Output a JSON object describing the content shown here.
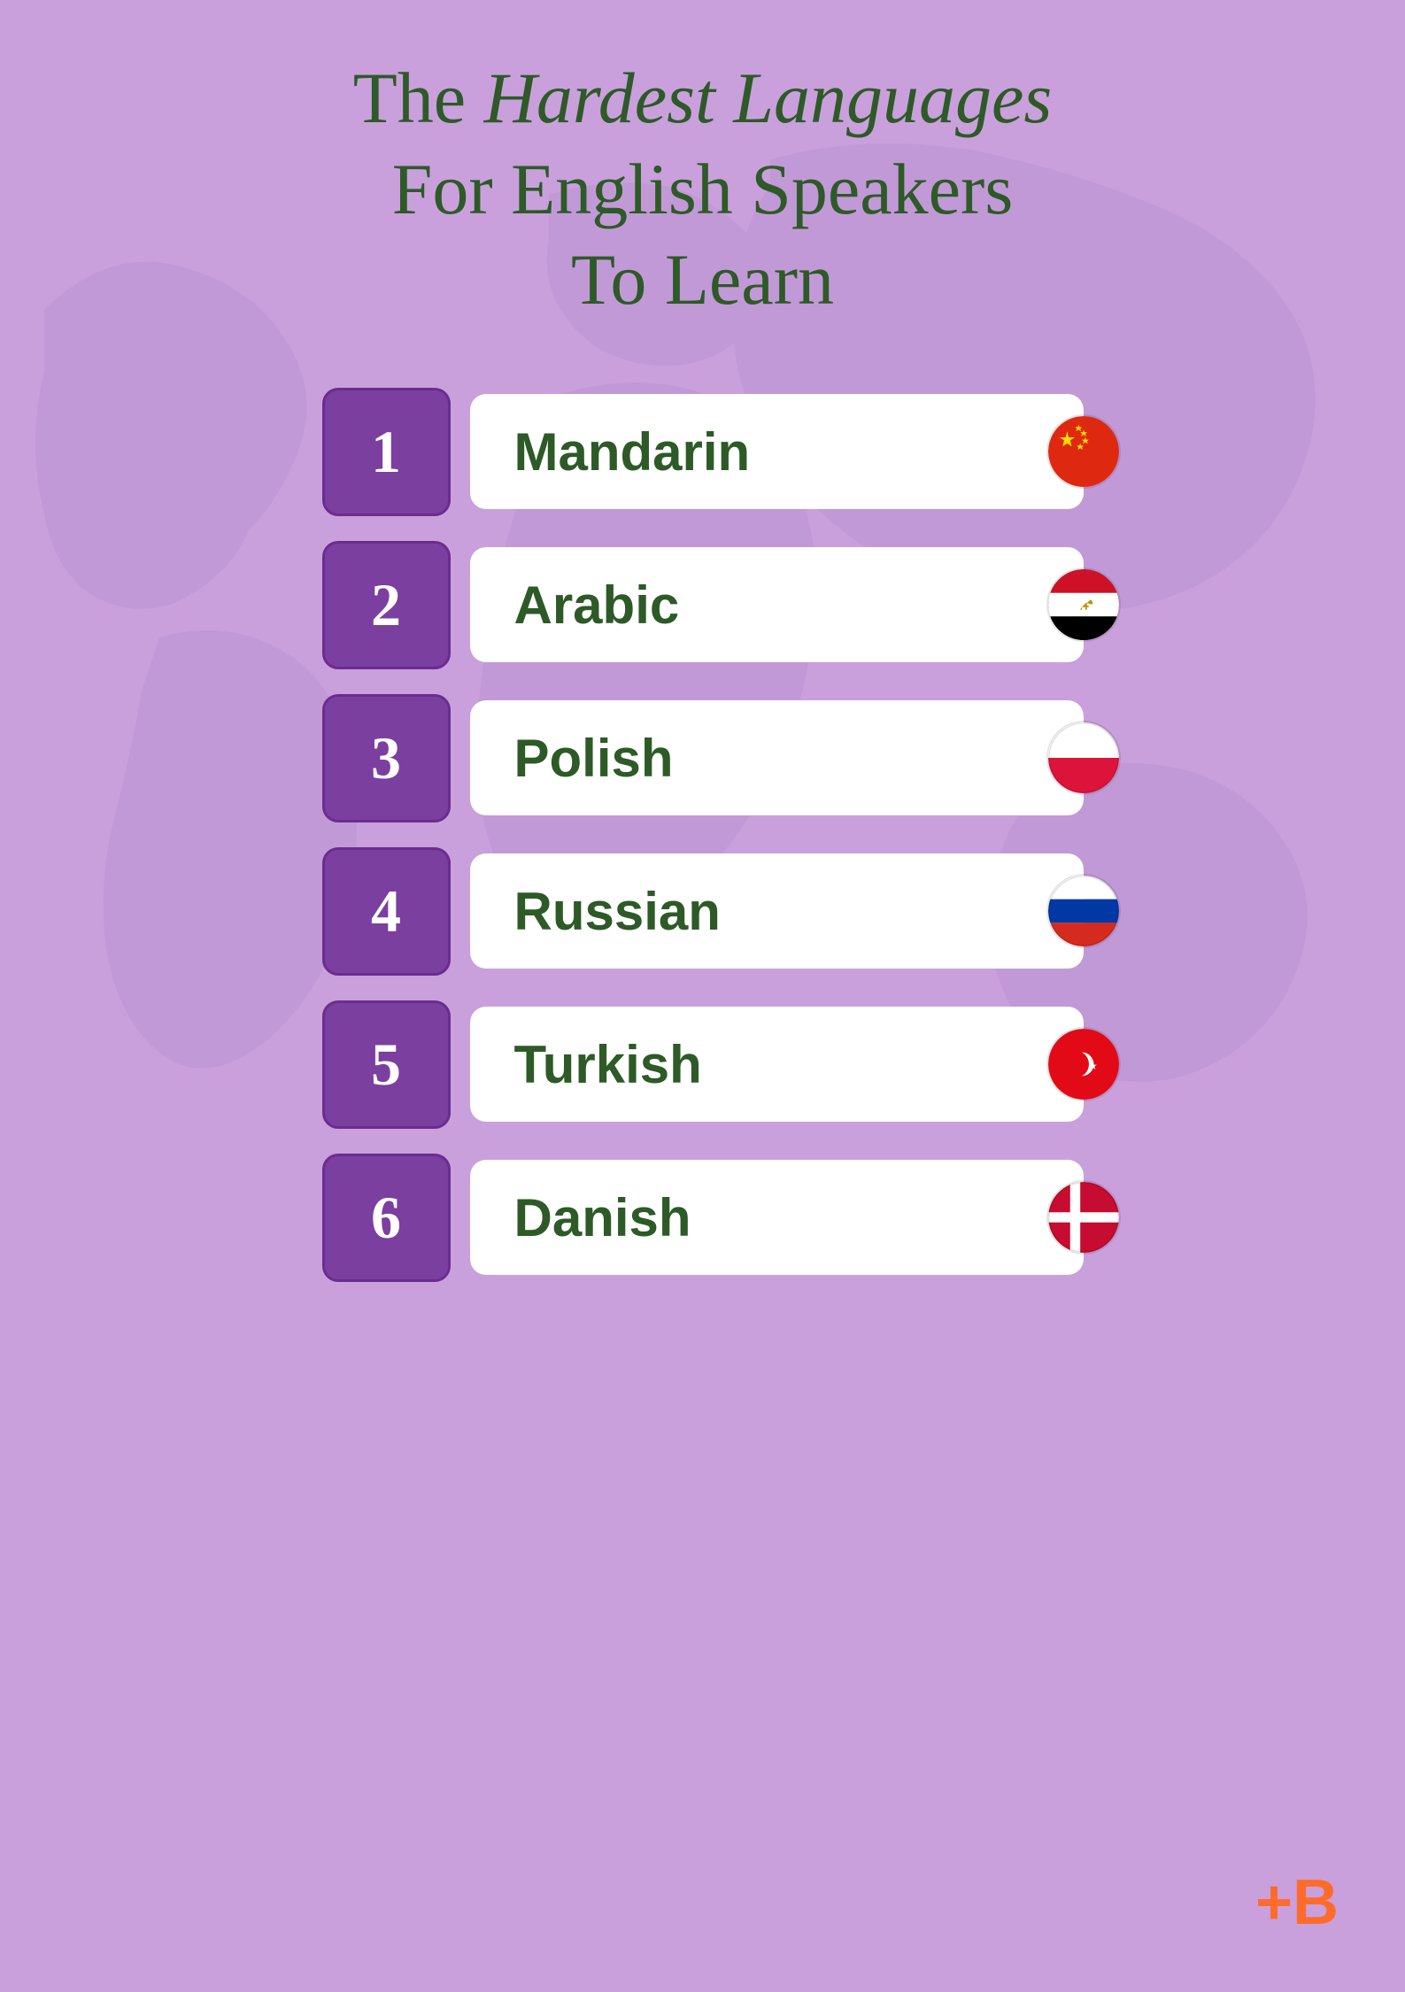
{
  "page": {
    "background_color": "#c9a0dc",
    "title": {
      "line1_normal": "The ",
      "line1_italic": "Hardest Languages",
      "line2": "For English Speakers",
      "line3": "To Learn"
    },
    "brand": "+B",
    "items": [
      {
        "rank": "1",
        "language": "Mandarin",
        "flag": "china"
      },
      {
        "rank": "2",
        "language": "Arabic",
        "flag": "egypt"
      },
      {
        "rank": "3",
        "language": "Polish",
        "flag": "poland"
      },
      {
        "rank": "4",
        "language": "Russian",
        "flag": "russia"
      },
      {
        "rank": "5",
        "language": "Turkish",
        "flag": "turkey"
      },
      {
        "rank": "6",
        "language": "Danish",
        "flag": "denmark"
      }
    ]
  }
}
